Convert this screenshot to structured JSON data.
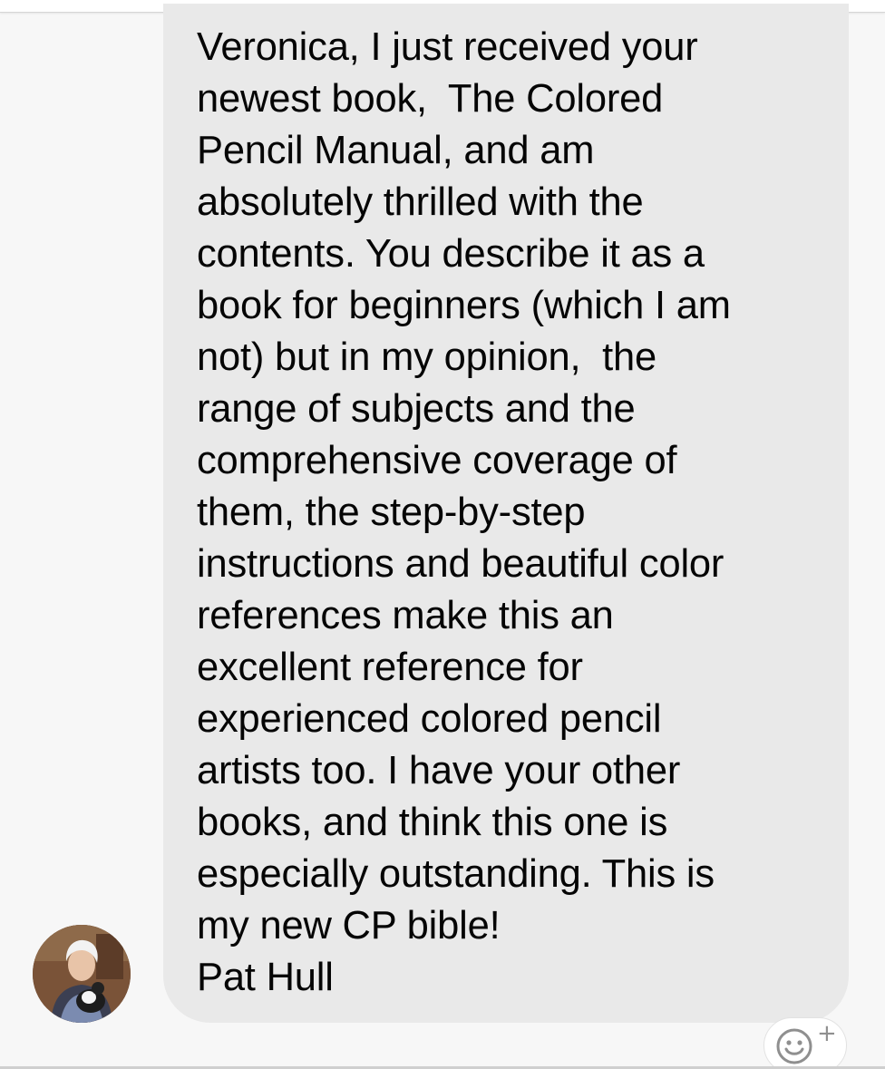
{
  "message": {
    "text": "Veronica, I just received your\nnewest book,  The Colored\nPencil Manual, and am\nabsolutely thrilled with the\ncontents. You describe it as a\nbook for beginners (which I am\nnot) but in my opinion,  the\nrange of subjects and the\ncomprehensive coverage of\nthem, the step-by-step\ninstructions and beautiful color\nreferences make this an\nexcellent reference for\nexperienced colored pencil\nartists too. I have your other\nbooks, and think this one is\nespecially outstanding. This is\nmy new CP bible!\nPat Hull",
    "bubble_color": "#e9e9e9",
    "text_color": "#050505"
  },
  "sender": {
    "avatar_icon": "profile-photo"
  },
  "reaction": {
    "icon": "smiley-add-icon",
    "plus": "+"
  }
}
